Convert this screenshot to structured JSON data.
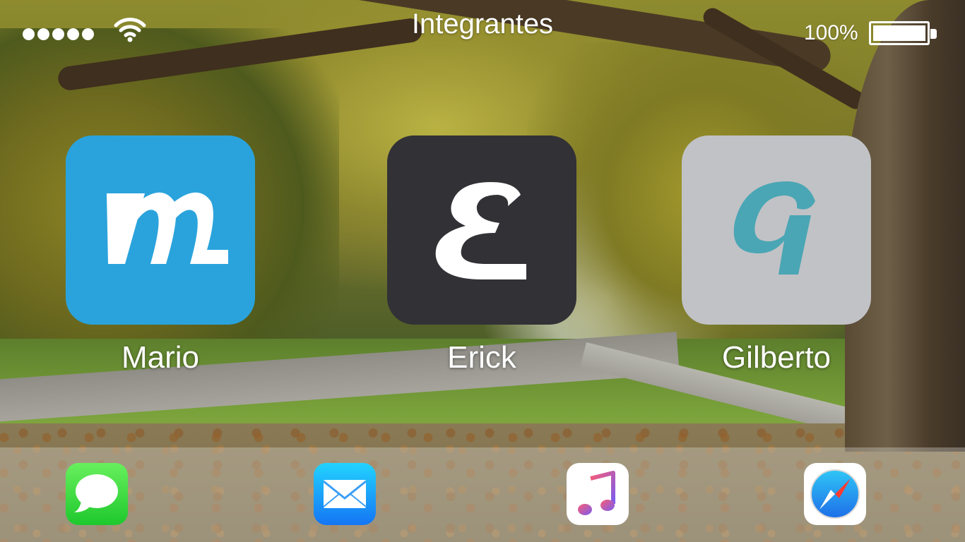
{
  "status_bar": {
    "title": "Integrantes",
    "battery_percent": "100%",
    "battery_level": 1.0,
    "signal_dots": 5,
    "wifi_icon": "wifi-icon"
  },
  "apps": [
    {
      "name": "Mario",
      "glyph": "M",
      "tile_color": "#2aa3dc",
      "glyph_color": "#ffffff"
    },
    {
      "name": "Erick",
      "glyph": "E",
      "tile_color": "#323136",
      "glyph_color": "#ffffff"
    },
    {
      "name": "Gilberto",
      "glyph": "G",
      "tile_color": "#c1c2c6",
      "glyph_color": "#4aa6b4"
    }
  ],
  "dock": [
    {
      "icon": "messages-icon"
    },
    {
      "icon": "mail-icon"
    },
    {
      "icon": "music-icon"
    },
    {
      "icon": "safari-icon"
    }
  ]
}
